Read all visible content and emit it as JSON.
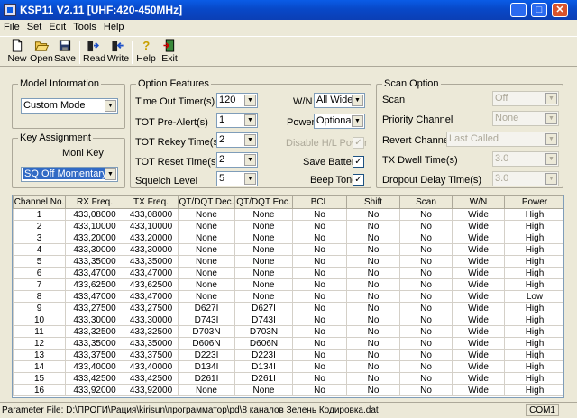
{
  "window": {
    "title": "KSP11 V2.11    [UHF:420-450MHz]"
  },
  "titlebar_buttons": {
    "minimize": "_",
    "maximize": "□",
    "close": "✕"
  },
  "menu": [
    "File",
    "Set",
    "Edit",
    "Tools",
    "Help"
  ],
  "toolbar": {
    "new": "New",
    "open": "Open",
    "save": "Save",
    "read": "Read",
    "write": "Write",
    "help": "Help",
    "exit": "Exit"
  },
  "model_info": {
    "legend": "Model Information",
    "value": "Custom Mode"
  },
  "key_assignment": {
    "legend": "Key Assignment",
    "moni_key_label": "Moni Key",
    "moni_key_value": "SQ Off Momentary"
  },
  "option_features": {
    "legend": "Option Features",
    "time_out_timer": {
      "label": "Time Out Timer(s)",
      "value": "120"
    },
    "tot_pre_alert": {
      "label": "TOT Pre-Alert(s)",
      "value": "1"
    },
    "tot_rekey_time": {
      "label": "TOT Rekey Time(s)",
      "value": "2"
    },
    "tot_reset_time": {
      "label": "TOT Reset Time(s)",
      "value": "2"
    },
    "squelch_level": {
      "label": "Squelch Level",
      "value": "5"
    },
    "wn": {
      "label": "W/N",
      "value": "All Wide"
    },
    "power": {
      "label": "Power",
      "value": "Optional"
    },
    "disable_hl_power": {
      "label": "Disable H/L Power",
      "checked": "✓"
    },
    "save_battery": {
      "label": "Save Battery",
      "checked": "✓"
    },
    "beep_tone": {
      "label": "Beep Tone",
      "checked": "✓"
    }
  },
  "scan_option": {
    "legend": "Scan Option",
    "scan": {
      "label": "Scan",
      "value": "Off"
    },
    "priority_channel": {
      "label": "Priority Channel",
      "value": "None"
    },
    "revert_channel": {
      "label": "Revert Channel",
      "value": "Last Called"
    },
    "tx_dwell_time": {
      "label": "TX Dwell Time(s)",
      "value": "3.0"
    },
    "dropout_delay_time": {
      "label": "Dropout Delay Time(s)",
      "value": "3.0"
    }
  },
  "table": {
    "columns": [
      "Channel No.",
      "RX Freq.",
      "TX Freq.",
      "QT/DQT Dec.",
      "QT/DQT Enc.",
      "BCL",
      "Shift",
      "Scan",
      "W/N",
      "Power"
    ],
    "rows": [
      [
        "1",
        "433,08000",
        "433,08000",
        "None",
        "None",
        "No",
        "No",
        "No",
        "Wide",
        "High"
      ],
      [
        "2",
        "433,10000",
        "433,10000",
        "None",
        "None",
        "No",
        "No",
        "No",
        "Wide",
        "High"
      ],
      [
        "3",
        "433,20000",
        "433,20000",
        "None",
        "None",
        "No",
        "No",
        "No",
        "Wide",
        "High"
      ],
      [
        "4",
        "433,30000",
        "433,30000",
        "None",
        "None",
        "No",
        "No",
        "No",
        "Wide",
        "High"
      ],
      [
        "5",
        "433,35000",
        "433,35000",
        "None",
        "None",
        "No",
        "No",
        "No",
        "Wide",
        "High"
      ],
      [
        "6",
        "433,47000",
        "433,47000",
        "None",
        "None",
        "No",
        "No",
        "No",
        "Wide",
        "High"
      ],
      [
        "7",
        "433,62500",
        "433,62500",
        "None",
        "None",
        "No",
        "No",
        "No",
        "Wide",
        "High"
      ],
      [
        "8",
        "433,47000",
        "433,47000",
        "None",
        "None",
        "No",
        "No",
        "No",
        "Wide",
        "Low"
      ],
      [
        "9",
        "433,27500",
        "433,27500",
        "D627I",
        "D627I",
        "No",
        "No",
        "No",
        "Wide",
        "High"
      ],
      [
        "10",
        "433,30000",
        "433,30000",
        "D743I",
        "D743I",
        "No",
        "No",
        "No",
        "Wide",
        "High"
      ],
      [
        "11",
        "433,32500",
        "433,32500",
        "D703N",
        "D703N",
        "No",
        "No",
        "No",
        "Wide",
        "High"
      ],
      [
        "12",
        "433,35000",
        "433,35000",
        "D606N",
        "D606N",
        "No",
        "No",
        "No",
        "Wide",
        "High"
      ],
      [
        "13",
        "433,37500",
        "433,37500",
        "D223I",
        "D223I",
        "No",
        "No",
        "No",
        "Wide",
        "High"
      ],
      [
        "14",
        "433,40000",
        "433,40000",
        "D134I",
        "D134I",
        "No",
        "No",
        "No",
        "Wide",
        "High"
      ],
      [
        "15",
        "433,42500",
        "433,42500",
        "D261I",
        "D261I",
        "No",
        "No",
        "No",
        "Wide",
        "High"
      ],
      [
        "16",
        "433,92000",
        "433,92000",
        "None",
        "None",
        "No",
        "No",
        "No",
        "Wide",
        "High"
      ]
    ]
  },
  "status": {
    "path": "Parameter File: D:\\ПРОГИ\\Рация\\kirisun\\программатор\\pd\\8 каналов Зелень Кодировка.dat",
    "port": "COM1"
  }
}
